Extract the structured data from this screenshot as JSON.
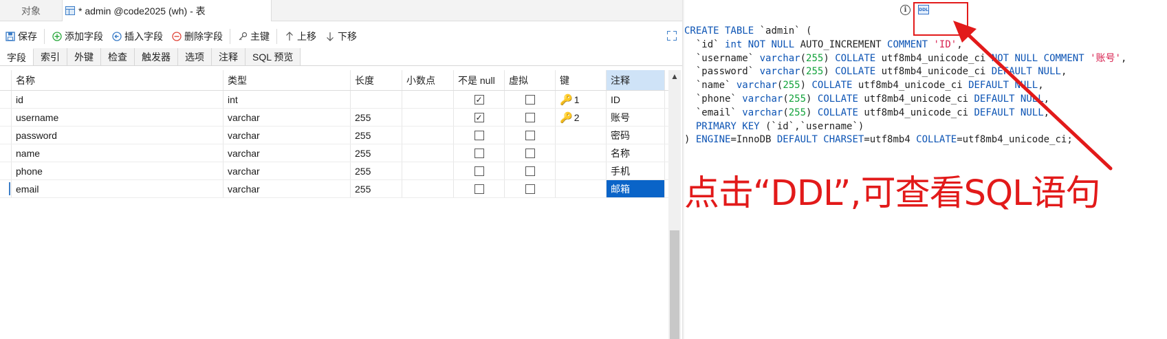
{
  "window_tabs": [
    {
      "label": "对象"
    },
    {
      "label": "* admin @code2025 (wh) - 表"
    }
  ],
  "toolbar": {
    "save": "保存",
    "add_field": "添加字段",
    "insert_field": "插入字段",
    "delete_field": "删除字段",
    "primary_key": "主键",
    "move_up": "上移",
    "move_down": "下移"
  },
  "sub_tabs": [
    "字段",
    "索引",
    "外键",
    "检查",
    "触发器",
    "选项",
    "注释",
    "SQL 预览"
  ],
  "grid": {
    "headers": [
      "名称",
      "类型",
      "长度",
      "小数点",
      "不是 null",
      "虚拟",
      "键",
      "注释"
    ],
    "rows": [
      {
        "name": "id",
        "type": "int",
        "length": "",
        "decimals": "",
        "not_null": true,
        "virtual": false,
        "key": "1",
        "comment": "ID"
      },
      {
        "name": "username",
        "type": "varchar",
        "length": "255",
        "decimals": "",
        "not_null": true,
        "virtual": false,
        "key": "2",
        "comment": "账号"
      },
      {
        "name": "password",
        "type": "varchar",
        "length": "255",
        "decimals": "",
        "not_null": false,
        "virtual": false,
        "key": "",
        "comment": "密码"
      },
      {
        "name": "name",
        "type": "varchar",
        "length": "255",
        "decimals": "",
        "not_null": false,
        "virtual": false,
        "key": "",
        "comment": "名称"
      },
      {
        "name": "phone",
        "type": "varchar",
        "length": "255",
        "decimals": "",
        "not_null": false,
        "virtual": false,
        "key": "",
        "comment": "手机"
      },
      {
        "name": "email",
        "type": "varchar",
        "length": "255",
        "decimals": "",
        "not_null": false,
        "virtual": false,
        "key": "",
        "comment": "邮箱"
      }
    ],
    "selected_row": 5
  },
  "ddl": {
    "icon_text": "DDL",
    "lines": [
      [
        [
          "kw",
          "CREATE TABLE"
        ],
        [
          "t",
          " `admin` ("
        ]
      ],
      [
        [
          "t",
          "  `id` "
        ],
        [
          "kw",
          "int NOT NULL"
        ],
        [
          "t",
          " AUTO_INCREMENT "
        ],
        [
          "kw",
          "COMMENT"
        ],
        [
          "t",
          " "
        ],
        [
          "str",
          "'ID'"
        ],
        [
          "t",
          ","
        ]
      ],
      [
        [
          "t",
          "  `username` "
        ],
        [
          "kw",
          "varchar"
        ],
        [
          "t",
          "("
        ],
        [
          "num",
          "255"
        ],
        [
          "t",
          ") "
        ],
        [
          "kw",
          "COLLATE"
        ],
        [
          "t",
          " utf8mb4_unicode_ci "
        ],
        [
          "kw",
          "NOT NULL COMMENT"
        ],
        [
          "t",
          " "
        ],
        [
          "str",
          "'账号'"
        ],
        [
          "t",
          ","
        ]
      ],
      [
        [
          "t",
          "  `password` "
        ],
        [
          "kw",
          "varchar"
        ],
        [
          "t",
          "("
        ],
        [
          "num",
          "255"
        ],
        [
          "t",
          ") "
        ],
        [
          "kw",
          "COLLATE"
        ],
        [
          "t",
          " utf8mb4_unicode_ci "
        ],
        [
          "kw",
          "DEFAULT NULL"
        ],
        [
          "t",
          ","
        ]
      ],
      [
        [
          "t",
          "  `name` "
        ],
        [
          "kw",
          "varchar"
        ],
        [
          "t",
          "("
        ],
        [
          "num",
          "255"
        ],
        [
          "t",
          ") "
        ],
        [
          "kw",
          "COLLATE"
        ],
        [
          "t",
          " utf8mb4_unicode_ci "
        ],
        [
          "kw",
          "DEFAULT NULL"
        ],
        [
          "t",
          ","
        ]
      ],
      [
        [
          "t",
          "  `phone` "
        ],
        [
          "kw",
          "varchar"
        ],
        [
          "t",
          "("
        ],
        [
          "num",
          "255"
        ],
        [
          "t",
          ") "
        ],
        [
          "kw",
          "COLLATE"
        ],
        [
          "t",
          " utf8mb4_unicode_ci "
        ],
        [
          "kw",
          "DEFAULT NULL"
        ],
        [
          "t",
          ","
        ]
      ],
      [
        [
          "t",
          "  `email` "
        ],
        [
          "kw",
          "varchar"
        ],
        [
          "t",
          "("
        ],
        [
          "num",
          "255"
        ],
        [
          "t",
          ") "
        ],
        [
          "kw",
          "COLLATE"
        ],
        [
          "t",
          " utf8mb4_unicode_ci "
        ],
        [
          "kw",
          "DEFAULT NULL"
        ],
        [
          "t",
          ","
        ]
      ],
      [
        [
          "t",
          "  "
        ],
        [
          "kw",
          "PRIMARY KEY"
        ],
        [
          "t",
          " (`id`,`username`)"
        ]
      ],
      [
        [
          "t",
          ") "
        ],
        [
          "kw",
          "ENGINE"
        ],
        [
          "t",
          "=InnoDB "
        ],
        [
          "kw",
          "DEFAULT CHARSET"
        ],
        [
          "t",
          "=utf8mb4 "
        ],
        [
          "kw",
          "COLLATE"
        ],
        [
          "t",
          "=utf8mb4_unicode_ci;"
        ]
      ]
    ]
  },
  "annotation": {
    "text": "点击“DDL”,可查看SQL语句"
  },
  "colors": {
    "keyword": "#0b53b4",
    "number": "#11a23a",
    "string": "#d8214f",
    "annotation_red": "#e21a1a",
    "selection": "#0a64c8"
  }
}
